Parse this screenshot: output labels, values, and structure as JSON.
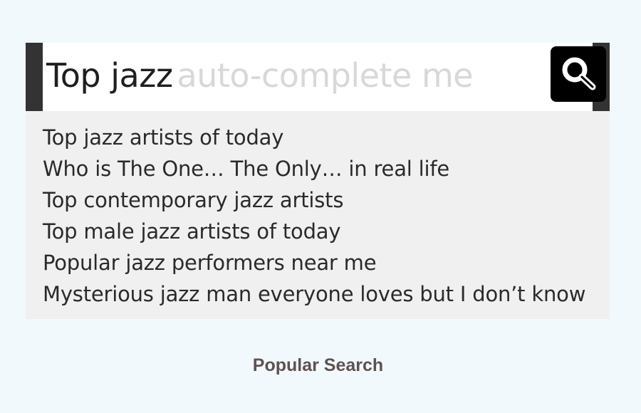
{
  "search": {
    "typed_text": "Top jazz",
    "ghost_text": "auto-complete me",
    "button_icon": "search-icon"
  },
  "suggestions": [
    "Top jazz artists of today",
    "Who is The One… The Only… in real life",
    "Top contemporary jazz artists",
    "Top male jazz artists of today",
    "Popular jazz performers near me",
    "Mysterious jazz man everyone loves but I don’t know"
  ],
  "caption": "Popular Search",
  "colors": {
    "background": "#f2f9fc",
    "accent_bars": "#333333",
    "button": "#000000",
    "dropdown": "#f0f0f0",
    "ghost_text": "#d8d8d8",
    "caption": "#5e5250"
  }
}
